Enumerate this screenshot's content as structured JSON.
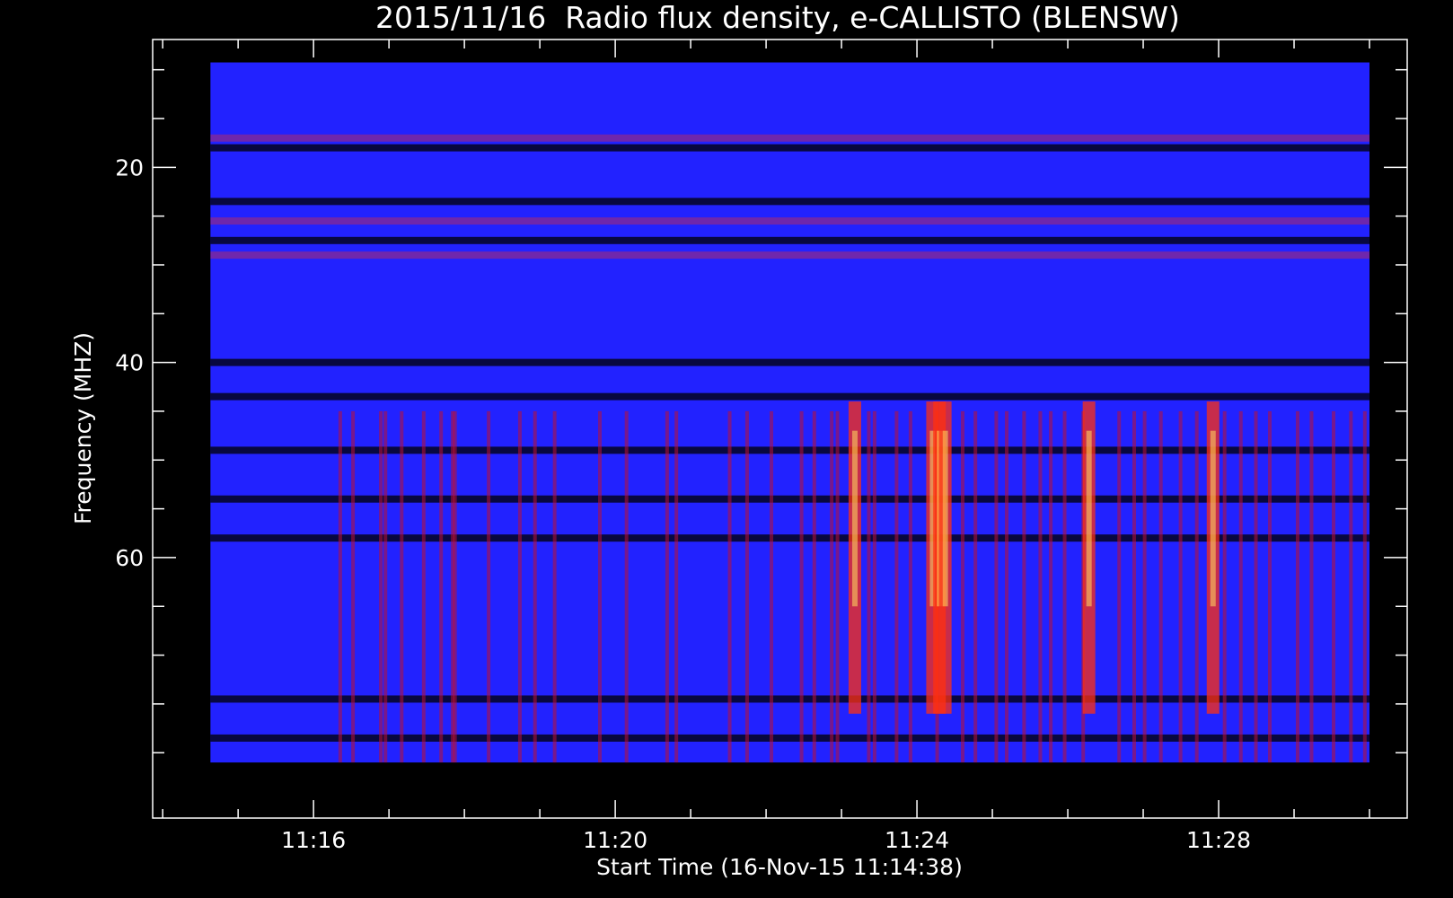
{
  "chart_data": {
    "type": "heatmap",
    "title": "2015/11/16  Radio flux density, e-CALLISTO (BLENSW)",
    "xlabel": "Start Time (16-Nov-15 11:14:38)",
    "ylabel": "Frequency (MHZ)",
    "x_unit": "minutes after 11:14",
    "xlim": [
      0.633,
      16
    ],
    "ylim": [
      81,
      9.25
    ],
    "x_axis_range": [
      -0.133,
      16.5
    ],
    "y_axis_range": [
      86.7,
      6.9
    ],
    "x_ticks": [
      {
        "value": 2,
        "label": "11:16"
      },
      {
        "value": 6,
        "label": "11:20"
      },
      {
        "value": 10,
        "label": "11:24"
      },
      {
        "value": 14,
        "label": "11:28"
      }
    ],
    "x_minor_step": 1,
    "y_ticks": [
      {
        "value": 20,
        "label": "20"
      },
      {
        "value": 40,
        "label": "40"
      },
      {
        "value": 60,
        "label": "60"
      }
    ],
    "y_minor_step": 5,
    "colorscale": [
      "#000000",
      "#1010d8",
      "#2222ff",
      "#c01030",
      "#ff3010",
      "#ff9020",
      "#ffe060"
    ],
    "background_color": "#2222ff",
    "burst_columns": [
      11.2,
      12.3,
      14.7,
      15.1,
      16.5,
      18.4,
      19.9,
      20.9,
      21.1,
      24.0,
      26.7,
      28.0,
      29.7,
      33.6,
      35.9,
      39.4,
      40.2,
      44.8,
      46.3,
      48.4,
      51.0,
      52.1,
      53.6,
      54.1,
      56.8,
      57.3,
      59.2,
      60.4,
      62.7,
      64.9,
      66.0,
      67.8,
      68.7,
      70.2,
      71.6,
      72.5,
      73.7,
      75.3,
      78.4,
      79.7,
      80.6,
      82.0,
      83.7,
      85.1,
      87.5,
      88.9,
      90.2,
      91.4,
      93.8,
      95.0,
      96.9,
      98.4,
      99.6
    ],
    "strong_columns": [
      55.6,
      62.3,
      62.9,
      63.4,
      75.8,
      86.5
    ],
    "dark_frequency_bands": [
      18.0,
      23.5,
      27.5,
      40.0,
      43.5,
      49.0,
      54.0,
      58.0,
      74.5,
      78.5
    ],
    "bright_frequency_bands": [
      17.0,
      25.5,
      29.0
    ]
  }
}
